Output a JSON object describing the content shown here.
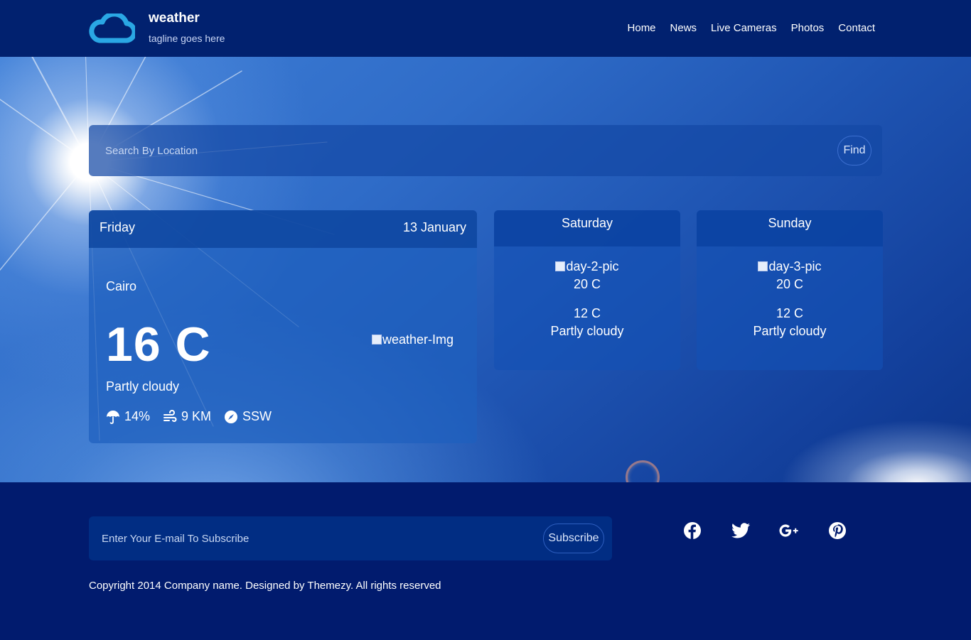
{
  "header": {
    "site_title": "weather",
    "tagline": "tagline goes here",
    "logo_icon": "cloud-icon",
    "logo_color": "#2aa7e4",
    "nav": [
      "Home",
      "News",
      "Live Cameras",
      "Photos",
      "Contact"
    ]
  },
  "search": {
    "placeholder": "Search By Location",
    "button_label": "Find"
  },
  "today": {
    "day": "Friday",
    "date": "13 January",
    "city": "Cairo",
    "temperature": "16 C",
    "image_alt": "weather-Img",
    "condition": "Partly cloudy",
    "rain_icon": "umbrella-icon",
    "rain": "14%",
    "wind_icon": "wind-icon",
    "wind": "9 KM",
    "direction_icon": "compass-icon",
    "direction": "SSW"
  },
  "forecast": [
    {
      "day": "Saturday",
      "image_alt": "day-2-pic",
      "high": "20 C",
      "low": "12 C",
      "condition": "Partly cloudy"
    },
    {
      "day": "Sunday",
      "image_alt": "day-3-pic",
      "high": "20 C",
      "low": "12 C",
      "condition": "Partly cloudy"
    }
  ],
  "footer": {
    "subscribe_placeholder": "Enter Your E-mail To Subscribe",
    "subscribe_label": "Subscribe",
    "socials": [
      "facebook-icon",
      "twitter-icon",
      "google-plus-icon",
      "pinterest-icon"
    ],
    "copyright": "Copyright 2014 Company name. Designed by Themezy. All rights reserved"
  },
  "colors": {
    "header_bg": "#01216f",
    "footer_bg": "#011b6e",
    "sky": "#2f6cc8"
  }
}
